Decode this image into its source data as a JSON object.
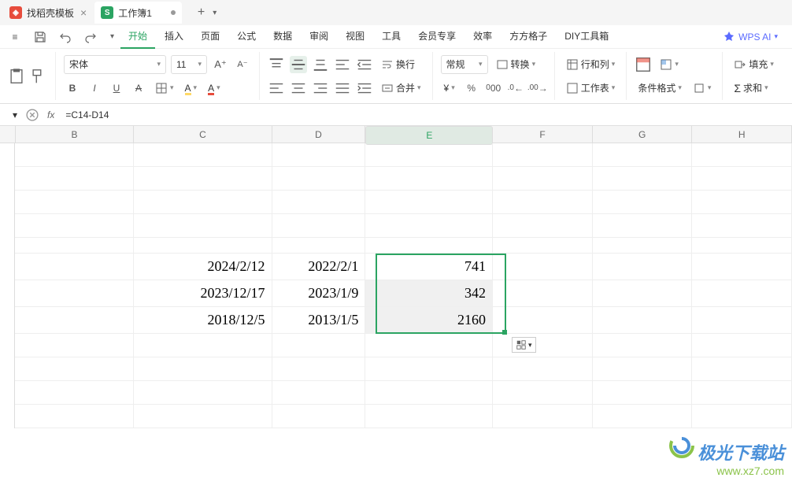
{
  "tabs": {
    "t1": {
      "label": "找稻壳模板"
    },
    "t2": {
      "label": "工作簿1"
    },
    "add": "+"
  },
  "menu_icons": {
    "menu": "≡"
  },
  "menu": {
    "start": "开始",
    "insert": "插入",
    "page": "页面",
    "formula": "公式",
    "data": "数据",
    "review": "审阅",
    "view": "视图",
    "tools": "工具",
    "member": "会员专享",
    "efficiency": "效率",
    "ff": "方方格子",
    "diy": "DIY工具箱"
  },
  "ai": {
    "label": "WPS AI"
  },
  "ribbon": {
    "font": {
      "name": "宋体",
      "size": "11"
    },
    "btns": {
      "bold": "B",
      "italic": "I",
      "underline": "U"
    },
    "wrap": "换行",
    "merge": "合并",
    "format": "常规",
    "convert": "转换",
    "rowcol": "行和列",
    "sheet": "工作表",
    "condfmt": "条件格式",
    "fill": "填充",
    "sum": "求和"
  },
  "formula": {
    "fx": "fx",
    "value": "=C14-D14"
  },
  "columns": {
    "B": "B",
    "C": "C",
    "D": "D",
    "E": "E",
    "F": "F",
    "G": "G",
    "H": "H"
  },
  "cells": {
    "C14": "2024/2/12",
    "D14": "2022/2/1",
    "E14": "741",
    "C15": "2023/12/17",
    "D15": "2023/1/9",
    "E15": "342",
    "C16": "2018/12/5",
    "D16": "2013/1/5",
    "E16": "2160"
  },
  "watermark": {
    "line1": "极光下载站",
    "line2": "www.xz7.com"
  },
  "chart_data": null
}
